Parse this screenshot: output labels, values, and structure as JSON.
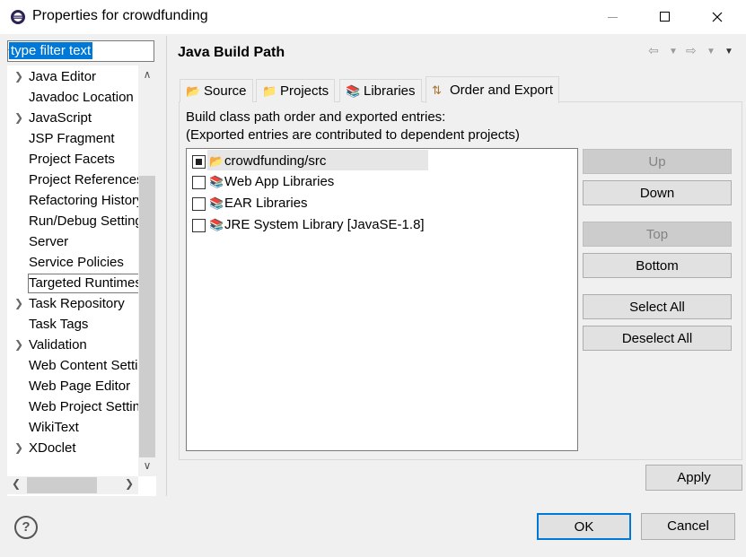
{
  "window": {
    "title": "Properties for crowdfunding"
  },
  "filter": {
    "placeholder": "type filter text",
    "value": "type filter text"
  },
  "tree": {
    "items": [
      {
        "label": "Java Editor",
        "expandable": true
      },
      {
        "label": "Javadoc Location",
        "expandable": false
      },
      {
        "label": "JavaScript",
        "expandable": true
      },
      {
        "label": "JSP Fragment",
        "expandable": false
      },
      {
        "label": "Project Facets",
        "expandable": false
      },
      {
        "label": "Project References",
        "expandable": false
      },
      {
        "label": "Refactoring History",
        "expandable": false
      },
      {
        "label": "Run/Debug Settings",
        "expandable": false
      },
      {
        "label": "Server",
        "expandable": false
      },
      {
        "label": "Service Policies",
        "expandable": false
      },
      {
        "label": "Targeted Runtimes",
        "expandable": false,
        "selected": true
      },
      {
        "label": "Task Repository",
        "expandable": true
      },
      {
        "label": "Task Tags",
        "expandable": false
      },
      {
        "label": "Validation",
        "expandable": true
      },
      {
        "label": "Web Content Settings",
        "expandable": false
      },
      {
        "label": "Web Page Editor",
        "expandable": false
      },
      {
        "label": "Web Project Settings",
        "expandable": false
      },
      {
        "label": "WikiText",
        "expandable": false
      },
      {
        "label": "XDoclet",
        "expandable": true
      }
    ]
  },
  "page": {
    "title": "Java Build Path",
    "tabs": [
      {
        "label": "Source",
        "icon": "source-folder-icon"
      },
      {
        "label": "Projects",
        "icon": "project-folder-icon"
      },
      {
        "label": "Libraries",
        "icon": "library-icon"
      },
      {
        "label": "Order and Export",
        "icon": "order-export-icon",
        "active": true
      }
    ],
    "description_line1": "Build class path order and exported entries:",
    "description_line2": "(Exported entries are contributed to dependent projects)",
    "entries": [
      {
        "label": "crowdfunding/src",
        "checked": true,
        "icon": "source-folder-icon"
      },
      {
        "label": "Web App Libraries",
        "checked": false,
        "icon": "library-icon"
      },
      {
        "label": "EAR Libraries",
        "checked": false,
        "icon": "library-icon"
      },
      {
        "label": "JRE System Library [JavaSE-1.8]",
        "checked": false,
        "icon": "library-icon"
      }
    ],
    "buttons": {
      "up": "Up",
      "down": "Down",
      "top": "Top",
      "bottom": "Bottom",
      "select_all": "Select All",
      "deselect_all": "Deselect All"
    },
    "apply": "Apply"
  },
  "footer": {
    "help": "?",
    "ok": "OK",
    "cancel": "Cancel"
  }
}
